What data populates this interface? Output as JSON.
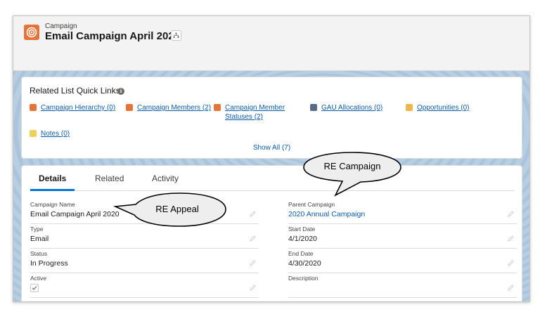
{
  "header": {
    "object_type": "Campaign",
    "title": "Email Campaign April 2020"
  },
  "quick_links": {
    "title": "Related List Quick Links",
    "items": [
      {
        "label": "Campaign Hierarchy (0)",
        "icon": "campaign-icon",
        "color": "#e5743a"
      },
      {
        "label": "Campaign Members (2)",
        "icon": "campaign-members-icon",
        "color": "#e5743a"
      },
      {
        "label": "Campaign Member Statuses (2)",
        "icon": "campaign-member-status-icon",
        "color": "#e5743a"
      },
      {
        "label": "GAU Allocations (0)",
        "icon": "gau-allocations-icon",
        "color": "#5a6b86"
      },
      {
        "label": "Opportunities (0)",
        "icon": "opportunities-icon",
        "color": "#f0b64a"
      },
      {
        "label": "Notes (0)",
        "icon": "notes-icon",
        "color": "#f0d05a"
      }
    ],
    "show_all": "Show All (7)"
  },
  "tabs": [
    {
      "label": "Details",
      "active": true
    },
    {
      "label": "Related",
      "active": false
    },
    {
      "label": "Activity",
      "active": false
    }
  ],
  "fields": {
    "left": [
      {
        "label": "Campaign Name",
        "value": "Email Campaign April 2020"
      },
      {
        "label": "Type",
        "value": "Email"
      },
      {
        "label": "Status",
        "value": "In Progress"
      },
      {
        "label": "Active",
        "value": "",
        "checked": true
      }
    ],
    "right": [
      {
        "label": "Parent Campaign",
        "value": "2020 Annual Campaign",
        "link": true
      },
      {
        "label": "Start Date",
        "value": "4/1/2020"
      },
      {
        "label": "End Date",
        "value": "4/30/2020"
      },
      {
        "label": "Description",
        "value": ""
      }
    ]
  },
  "callouts": {
    "re_campaign": "RE Campaign",
    "re_appeal": "RE Appeal"
  },
  "colors": {
    "brand_link": "#0b5cab",
    "accent_tab": "#0176d3",
    "campaign_icon": "#e5743a"
  }
}
